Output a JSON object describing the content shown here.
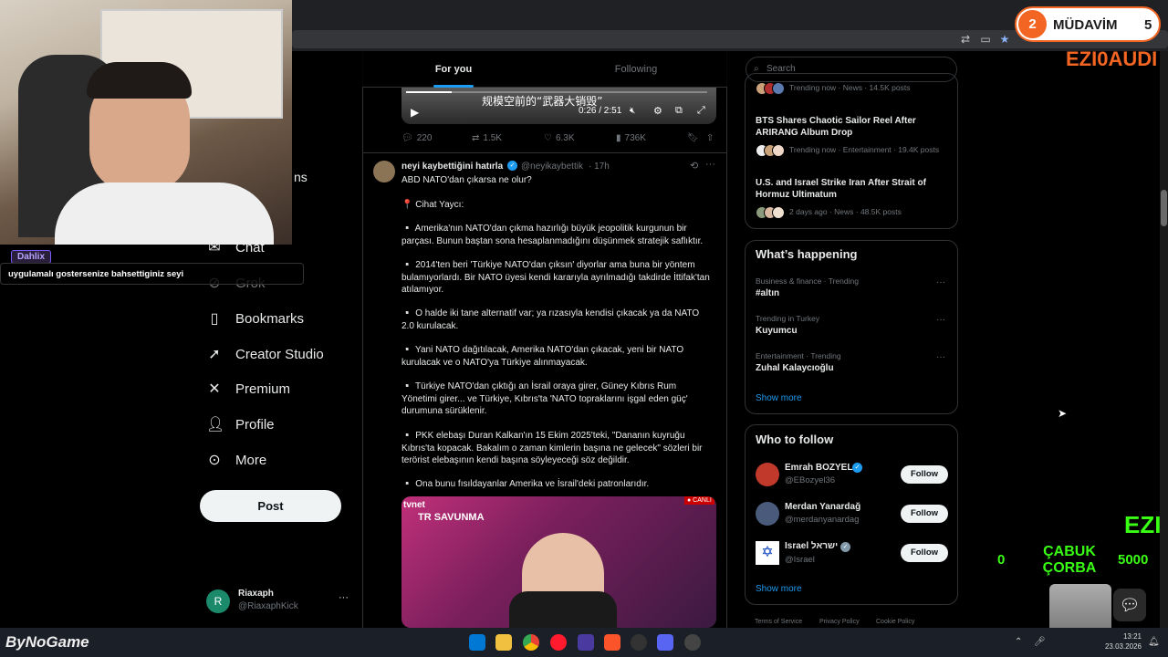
{
  "browser": {
    "icons": [
      "translate-icon",
      "screenshot-icon",
      "star-icon"
    ]
  },
  "sidebar": {
    "partial_label": "ns",
    "items": [
      {
        "label": "Chat",
        "icon": "chat-icon"
      },
      {
        "label": "Grok",
        "icon": "grok-icon"
      },
      {
        "label": "Bookmarks",
        "icon": "bookmark-icon"
      },
      {
        "label": "Creator Studio",
        "icon": "rocket-icon"
      },
      {
        "label": "Premium",
        "icon": "x-logo-icon"
      },
      {
        "label": "Profile",
        "icon": "profile-icon"
      },
      {
        "label": "More",
        "icon": "more-circle-icon"
      }
    ],
    "post_label": "Post",
    "account": {
      "initial": "R",
      "name": "Riaxaph",
      "handle": "@RiaxaphKick",
      "menu": "···"
    }
  },
  "feed": {
    "tabs": [
      {
        "label": "For you",
        "active": true
      },
      {
        "label": "Following",
        "active": false
      }
    ],
    "video": {
      "caption": "规模空前的“武器大销毁”",
      "time": "0:26 / 2:51",
      "progress": 0.15
    },
    "stats": {
      "replies": "220",
      "reposts": "1.5K",
      "likes": "6.3K",
      "views": "736K"
    },
    "tweet": {
      "author": "neyi kaybettiğini hatırla",
      "handle": "@neyikaybettik",
      "time": "· 17h",
      "lines": [
        "ABD NATO'dan çıkarsa ne olur?",
        "📍 Cihat Yaycı:",
        "▫️ Amerika'nın NATO'dan çıkma hazırlığı büyük jeopolitik kurgunun bir parçası. Bunun baştan sona hesaplanmadığını düşünmek stratejik saflıktır.",
        "▫️ 2014'ten beri 'Türkiye NATO'dan çıksın' diyorlar ama buna bir yöntem bulamıyorlardı. Bir NATO üyesi kendi kararıyla ayrılmadığı takdirde İttifak'tan atılamıyor.",
        "▫️ O halde iki tane alternatif var; ya rızasıyla kendisi çıkacak ya da NATO 2.0 kurulacak.",
        "▫️ Yani NATO dağıtılacak, Amerika NATO'dan çıkacak, yeni bir NATO kurulacak ve o NATO'ya Türkiye alınmayacak.",
        "▫️ Türkiye NATO'dan çıktığı an İsrail oraya girer, Güney Kıbrıs Rum Yönetimi girer... ve Türkiye, Kıbrıs'ta 'NATO topraklarını işgal eden güç' durumuna sürüklenir.",
        "▫️ PKK elebaşı Duran Kalkan'ın 15 Ekim 2025'teki, \"Dananın kuyruğu Kıbrıs'ta kopacak. Bakalım o zaman kimlerin başına ne gelecek\" sözleri bir terörist elebaşının kendi başına söyleyeceği söz değildir.",
        "▫️ Ona bunu fısıldayanlar Amerika ve İsrail'deki patronlarıdır."
      ],
      "image_labels": {
        "brand": "tvnet",
        "show": "TR SAVUNMA",
        "live": "● CANLI"
      }
    }
  },
  "right": {
    "search_placeholder": "Search",
    "trends_top": [
      {
        "title": "",
        "meta": "Trending now · News · 14.5K posts"
      },
      {
        "title": "BTS Shares Chaotic Sailor Reel After ARIRANG Album Drop",
        "meta": "Trending now · Entertainment · 19.4K posts"
      },
      {
        "title": "U.S. and Israel Strike Iran After Strait of Hormuz Ultimatum",
        "meta": "2 days ago · News · 48.5K posts"
      }
    ],
    "whats_happening": {
      "title": "What’s happening",
      "items": [
        {
          "meta": "Business & finance · Trending",
          "name": "#altın"
        },
        {
          "meta": "Trending in Turkey",
          "name": "Kuyumcu"
        },
        {
          "meta": "Entertainment · Trending",
          "name": "Zuhal Kalaycıoğlu"
        }
      ],
      "show_more": "Show more"
    },
    "who_to_follow": {
      "title": "Who to follow",
      "users": [
        {
          "name": "Emrah BOZYEL",
          "handle": "@EBozyel36",
          "button": "Follow"
        },
        {
          "name": "Merdan Yanardağ",
          "handle": "@merdanyanardag",
          "button": "Follow"
        },
        {
          "name": "Israel ישראל",
          "handle": "@Israel",
          "button": "Follow"
        }
      ],
      "show_more": "Show more"
    },
    "footer": [
      "Terms of Service",
      "Privacy Policy",
      "Cookie Policy"
    ]
  },
  "overlay": {
    "chat_user": "Dahlix",
    "chat_text": "uygulamalı gostersenize bahsettiginiz seyi",
    "badge": {
      "left": "2",
      "title": "MÜDAVİM",
      "right": "5"
    },
    "ticker": "EZI0AUDI",
    "ticker2": "EZI",
    "counter_left": "0",
    "soup_label": "ÇABUK ÇORBA",
    "counter_right": "5000",
    "logo": "ByNoGame"
  },
  "taskbar": {
    "time": "13:21",
    "date": "23.03.2026"
  },
  "colors": {
    "accent": "#1d9bf0",
    "badge_orange": "#f26522",
    "neon_green": "#39ff14"
  }
}
